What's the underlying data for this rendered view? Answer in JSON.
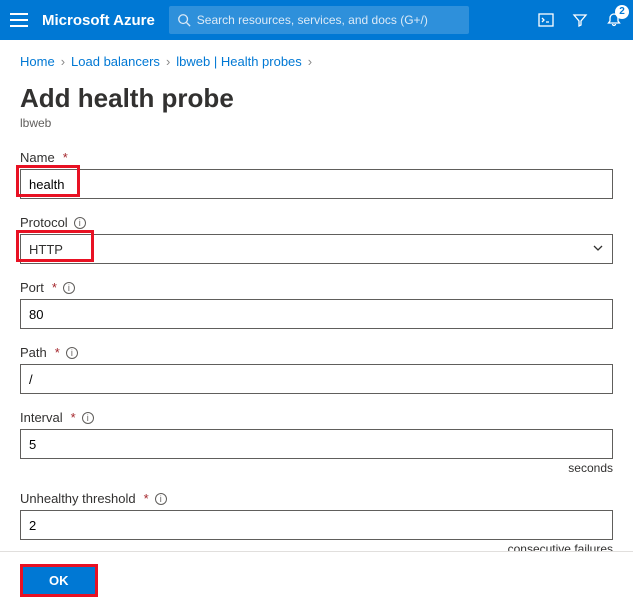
{
  "header": {
    "brand": "Microsoft Azure",
    "search_placeholder": "Search resources, services, and docs (G+/)",
    "notification_count": "2"
  },
  "breadcrumbs": {
    "items": [
      "Home",
      "Load balancers",
      "lbweb | Health probes"
    ]
  },
  "page": {
    "title": "Add health probe",
    "subtitle": "lbweb"
  },
  "fields": {
    "name": {
      "label": "Name",
      "value": "health"
    },
    "protocol": {
      "label": "Protocol",
      "value": "HTTP"
    },
    "port": {
      "label": "Port",
      "value": "80"
    },
    "path": {
      "label": "Path",
      "value": "/"
    },
    "interval": {
      "label": "Interval",
      "value": "5",
      "suffix": "seconds"
    },
    "unhealthy": {
      "label": "Unhealthy threshold",
      "value": "2",
      "suffix": "consecutive failures"
    }
  },
  "footer": {
    "ok": "OK"
  }
}
